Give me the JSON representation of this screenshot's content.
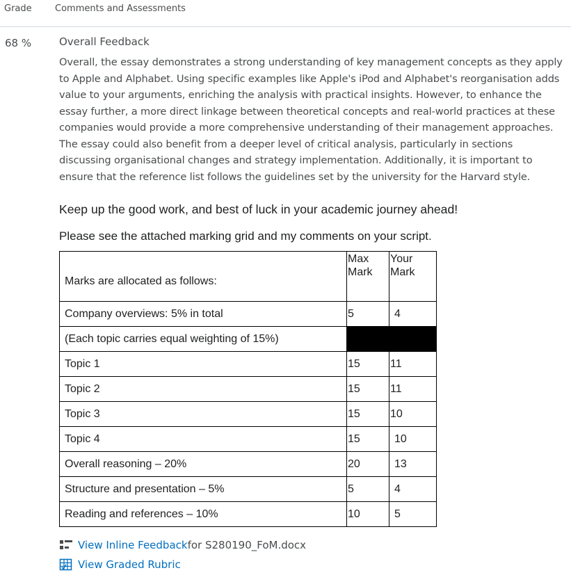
{
  "header": {
    "grade_label": "Grade",
    "comments_label": "Comments and Assessments"
  },
  "grade": {
    "value": "68 %"
  },
  "feedback": {
    "title": "Overall Feedback",
    "paragraph": "Overall, the essay demonstrates a strong understanding of key management concepts as they apply to Apple and Alphabet. Using specific examples like Apple's iPod and Alphabet's reorganisation adds value to your arguments, enriching the analysis with practical insights. However, to enhance the essay further, a more direct linkage between theoretical concepts and real-world practices at these companies would provide a more comprehensive understanding of their management approaches. The essay could also benefit from a deeper level of critical analysis, particularly in sections discussing organisational changes and strategy implementation. Additionally, it is important to ensure that the reference list follows the guidelines set by the university for the Harvard style.",
    "keep_up": "Keep up the good work, and best of luck in your academic journey ahead!",
    "please_see": "Please see the attached marking grid and my comments on your script."
  },
  "marks_table": {
    "head_label": "Marks are allocated as follows:",
    "head_max_line1": "Max",
    "head_max_line2": "Mark",
    "head_your_line1": "Your",
    "head_your_line2": "Mark",
    "rows": [
      {
        "label": "Company overviews: 5% in total",
        "max": "5",
        "your": "4"
      },
      {
        "label": "(Each topic carries equal weighting of 15%)",
        "max": "",
        "your": ""
      },
      {
        "label": "Topic 1",
        "max": "15",
        "your": "11"
      },
      {
        "label": "Topic 2",
        "max": "15",
        "your": "11"
      },
      {
        "label": "Topic 3",
        "max": "15",
        "your": "10"
      },
      {
        "label": "Topic 4",
        "max": "15",
        "your": "10"
      },
      {
        "label": "Overall reasoning – 20%",
        "max": "20",
        "your": "13"
      },
      {
        "label": "Structure and presentation – 5%",
        "max": "5",
        "your": "4"
      },
      {
        "label": "Reading and references – 10%",
        "max": "10",
        "your": "5"
      }
    ]
  },
  "links": {
    "inline_feedback_label": "View Inline Feedback",
    "inline_feedback_suffix": " for S280190_FoM.docx",
    "inline_feedback_icon": "inline-feedback-icon",
    "rubric_label": "View Graded Rubric",
    "rubric_icon": "rubric-icon"
  },
  "colors": {
    "link": "#006fbf",
    "text": "#494c4e",
    "divider": "#d3d9e3"
  }
}
